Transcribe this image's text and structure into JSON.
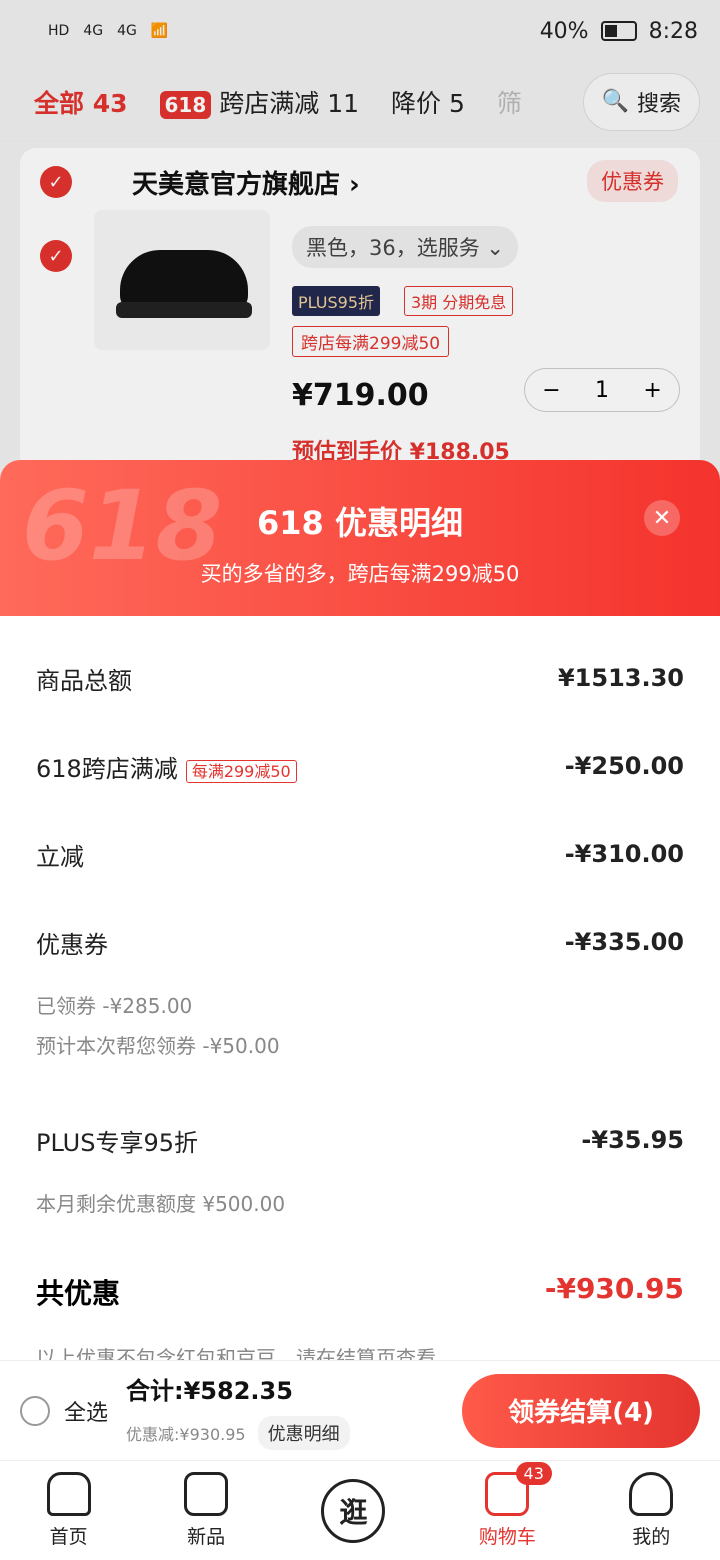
{
  "status": {
    "time": "8:28",
    "battery": "40%",
    "signal": [
      "HD",
      "4G",
      "4G"
    ]
  },
  "tabs": [
    {
      "label": "全部 43",
      "active": true
    },
    {
      "label": "跨店满减 11",
      "prefix": "618"
    },
    {
      "label": "降价 5"
    },
    {
      "label": "筛"
    }
  ],
  "search_label": "搜索",
  "store": {
    "name": "天美意官方旗舰店 ›",
    "coupon_tag": "优惠券"
  },
  "item": {
    "spec": "黑色，36，选服务 ⌄",
    "plus": "PLUS95折",
    "fenqi": "3期 分期免息",
    "promo": "跨店每满299减50",
    "price": "¥719.00",
    "qty": "1",
    "est": "预估到手价 ¥188.05"
  },
  "sheet": {
    "title": "618 优惠明细",
    "subtitle": "买的多省的多，跨店每满299减50",
    "close": "✕",
    "rows": [
      {
        "label": "商品总额",
        "amount": "¥1513.30"
      },
      {
        "label": "618跨店满减",
        "tag": "每满299减50",
        "amount": "-¥250.00"
      },
      {
        "label": "立减",
        "amount": "-¥310.00"
      },
      {
        "label": "优惠券",
        "amount": "-¥335.00",
        "subs": [
          "已领券 -¥285.00",
          "预计本次帮您领券 -¥50.00"
        ]
      },
      {
        "label": "PLUS专享95折",
        "amount": "-¥35.95",
        "subs": [
          "本月剩余优惠额度 ¥500.00"
        ]
      }
    ],
    "total_label": "共优惠",
    "total_amount": "-¥930.95",
    "note": "以上优惠不包含红包和京豆，请在结算页查看"
  },
  "footer": {
    "select_all": "全选",
    "total": "合计:¥582.35",
    "discount": "优惠减:¥930.95",
    "detail_btn": "优惠明细",
    "checkout": "领券结算(4)"
  },
  "nav": [
    {
      "label": "首页"
    },
    {
      "label": "新品"
    },
    {
      "label": "逛"
    },
    {
      "label": "购物车",
      "badge": "43",
      "active": true
    },
    {
      "label": "我的"
    }
  ]
}
